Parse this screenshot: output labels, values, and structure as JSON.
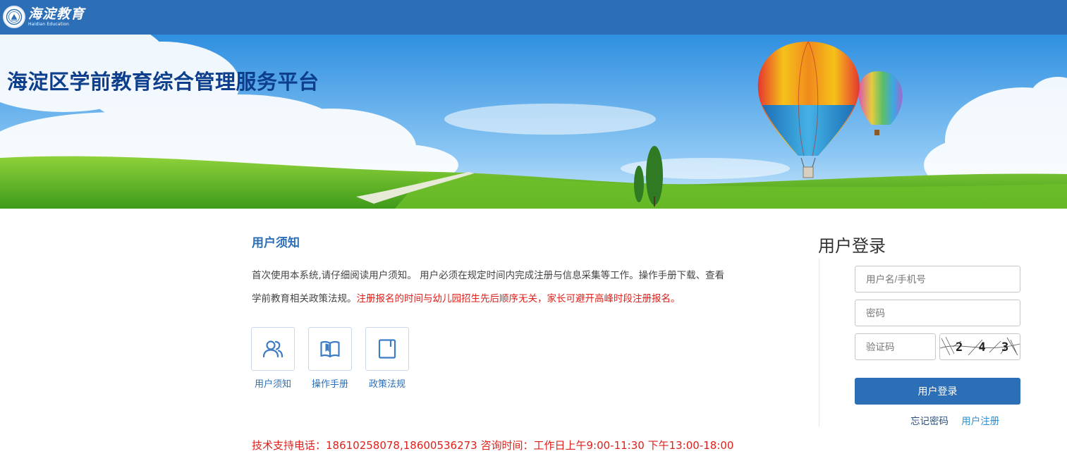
{
  "header": {
    "logo_cn": "海淀教育",
    "logo_en": "Haidian Education",
    "bg_color": "#2c6fb7"
  },
  "banner": {
    "title": "海淀区学前教育综合管理服务平台"
  },
  "notice": {
    "title": "用户须知",
    "text_line1": "首次使用本系统,请仔细阅读用户须知。 用户必须在规定时间内完成注册与信息采集等工作。操作手册下载、查看",
    "text_line2_normal": "学前教育相关政策法规。",
    "text_line2_red": "注册报名的时间与幼儿园招生先后顺序无关，家长可避开高峰时段注册报名。"
  },
  "quick_links": [
    {
      "label": "用户须知",
      "icon": "users-icon"
    },
    {
      "label": "操作手册",
      "icon": "book-icon"
    },
    {
      "label": "政策法规",
      "icon": "document-icon"
    }
  ],
  "support": {
    "text": "技术支持电话：18610258078,18600536273   咨询时间：工作日上午9:00-11:30  下午13:00-18:00"
  },
  "login": {
    "title": "用户登录",
    "username_placeholder": "用户名/手机号",
    "password_placeholder": "密码",
    "captcha_placeholder": "验证码",
    "captcha_text": "2 4 3",
    "submit_label": "用户登录",
    "forgot_label": "忘记密码",
    "register_label": "用户注册"
  },
  "colors": {
    "primary": "#2c6fb7",
    "alert_red": "#e0201b",
    "title_blue": "#0d3f8d"
  }
}
